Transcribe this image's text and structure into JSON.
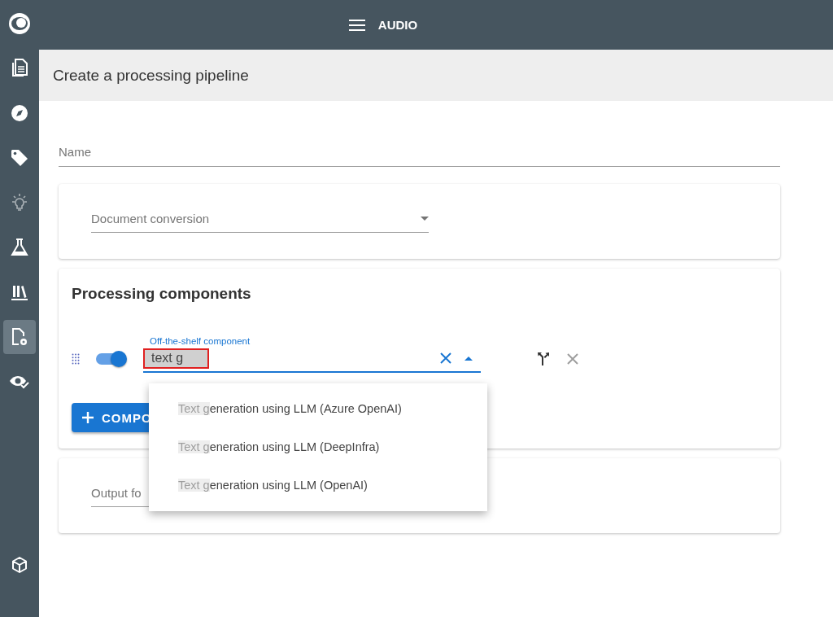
{
  "sidebar": {
    "items": [
      {
        "kind": "logo",
        "selected": false,
        "disabled": false
      },
      {
        "kind": "documents",
        "selected": false,
        "disabled": false
      },
      {
        "kind": "compass",
        "selected": false,
        "disabled": false
      },
      {
        "kind": "tag",
        "selected": false,
        "disabled": false
      },
      {
        "kind": "bulb",
        "selected": false,
        "disabled": true
      },
      {
        "kind": "flask",
        "selected": false,
        "disabled": false
      },
      {
        "kind": "library",
        "selected": false,
        "disabled": false
      },
      {
        "kind": "doc-gear",
        "selected": true,
        "disabled": false
      },
      {
        "kind": "eye-check",
        "selected": false,
        "disabled": false
      }
    ],
    "bottom_items": [
      {
        "kind": "cube",
        "selected": false,
        "disabled": false
      }
    ]
  },
  "top_bar": {
    "title": "AUDIO"
  },
  "page": {
    "title": "Create a processing pipeline"
  },
  "name_field": {
    "placeholder": "Name"
  },
  "conversion_select": {
    "placeholder": "Document conversion"
  },
  "processing": {
    "heading": "Processing components",
    "component": {
      "enabled": true,
      "label": "Off-the-shelf component",
      "value": "text g",
      "highlighted": true
    },
    "add_button": "COMPO"
  },
  "output_select": {
    "placeholder": "Output fo"
  },
  "dropdown": {
    "options": [
      {
        "match": "Text g",
        "rest": "eneration using LLM (Azure OpenAI)"
      },
      {
        "match": "Text g",
        "rest": "eneration using LLM (DeepInfra)"
      },
      {
        "match": "Text g",
        "rest": "eneration using LLM (OpenAI)"
      }
    ]
  }
}
